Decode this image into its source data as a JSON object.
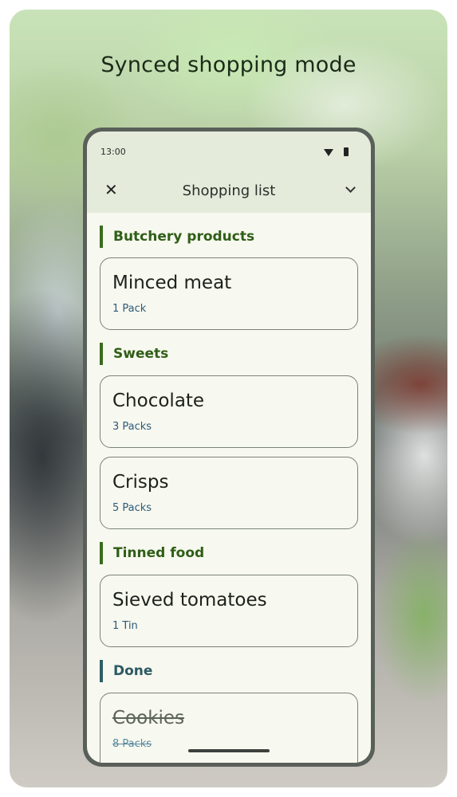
{
  "headline": "Synced shopping mode",
  "status": {
    "time": "13:00",
    "wifi_icon": "wifi-icon",
    "battery_icon": "battery-icon"
  },
  "app_bar": {
    "close_icon": "close-icon",
    "title": "Shopping list",
    "menu_icon": "chevron-down-icon"
  },
  "sections": [
    {
      "title": "Butchery products",
      "items": [
        {
          "name": "Minced meat",
          "qty": "1 Pack",
          "done": false
        }
      ]
    },
    {
      "title": "Sweets",
      "items": [
        {
          "name": "Chocolate",
          "qty": "3 Packs",
          "done": false
        },
        {
          "name": "Crisps",
          "qty": "5 Packs",
          "done": false
        }
      ]
    },
    {
      "title": "Tinned food",
      "items": [
        {
          "name": "Sieved tomatoes",
          "qty": "1 Tin",
          "done": false
        }
      ]
    },
    {
      "title": "Done",
      "items": [
        {
          "name": "Cookies",
          "qty": "8 Packs",
          "done": true
        }
      ]
    }
  ],
  "colors": {
    "section_accent": "#3a6b20",
    "done_accent": "#2c5f66",
    "qty_text": "#2c5a7a",
    "top_bar": "#e4ebdb",
    "screen_bg": "#f7f8ef"
  }
}
